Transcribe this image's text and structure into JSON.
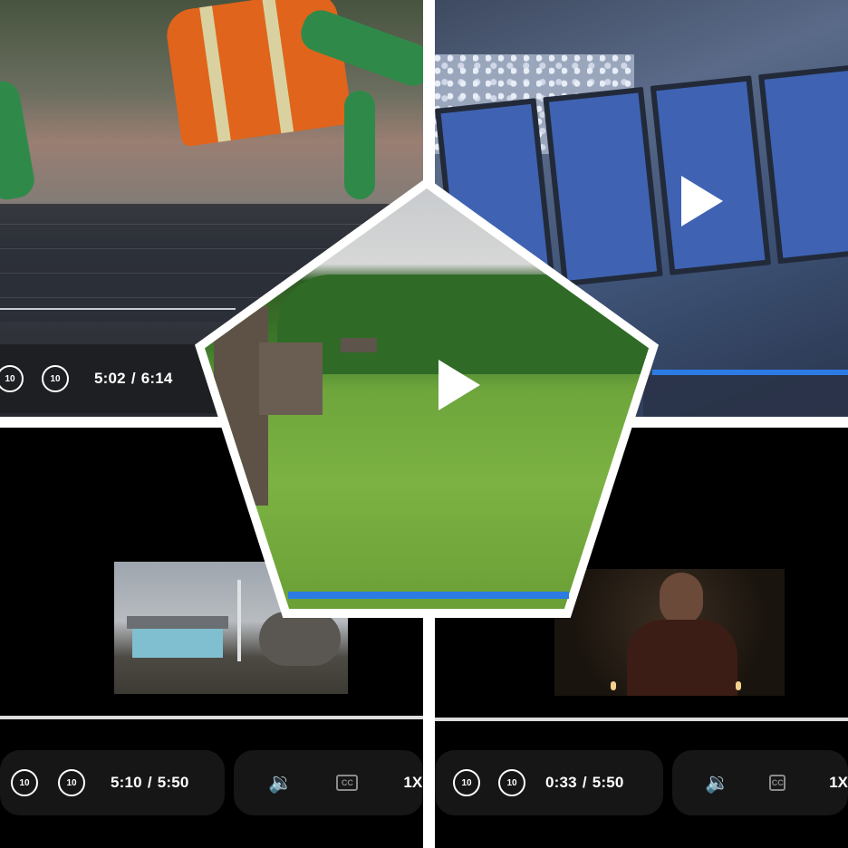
{
  "players": [
    {
      "id": "solar-install",
      "elapsed": "5:02",
      "separator": "/",
      "duration": "6:14",
      "skip_back_label": "10",
      "skip_forward_label": "10"
    },
    {
      "id": "solar-panels",
      "play_icon": "play-icon",
      "progress_fraction": 0.95
    },
    {
      "id": "village-windmill",
      "elapsed": "5:10",
      "separator": "/",
      "duration": "5:50",
      "skip_back_label": "10",
      "skip_forward_label": "10",
      "cc_label": "CC",
      "speed_label": "1X"
    },
    {
      "id": "candlelight-speaker",
      "elapsed": "0:33",
      "separator": "/",
      "duration": "5:50",
      "skip_back_label": "10",
      "skip_forward_label": "10",
      "cc_label": "CC",
      "speed_label": "1X"
    }
  ],
  "featured": {
    "id": "open-air-museum",
    "play_icon": "play-icon",
    "progress_fraction": 0.98
  },
  "colors": {
    "accent": "#2c7be5",
    "pill": "#161616",
    "background": "#000000"
  }
}
